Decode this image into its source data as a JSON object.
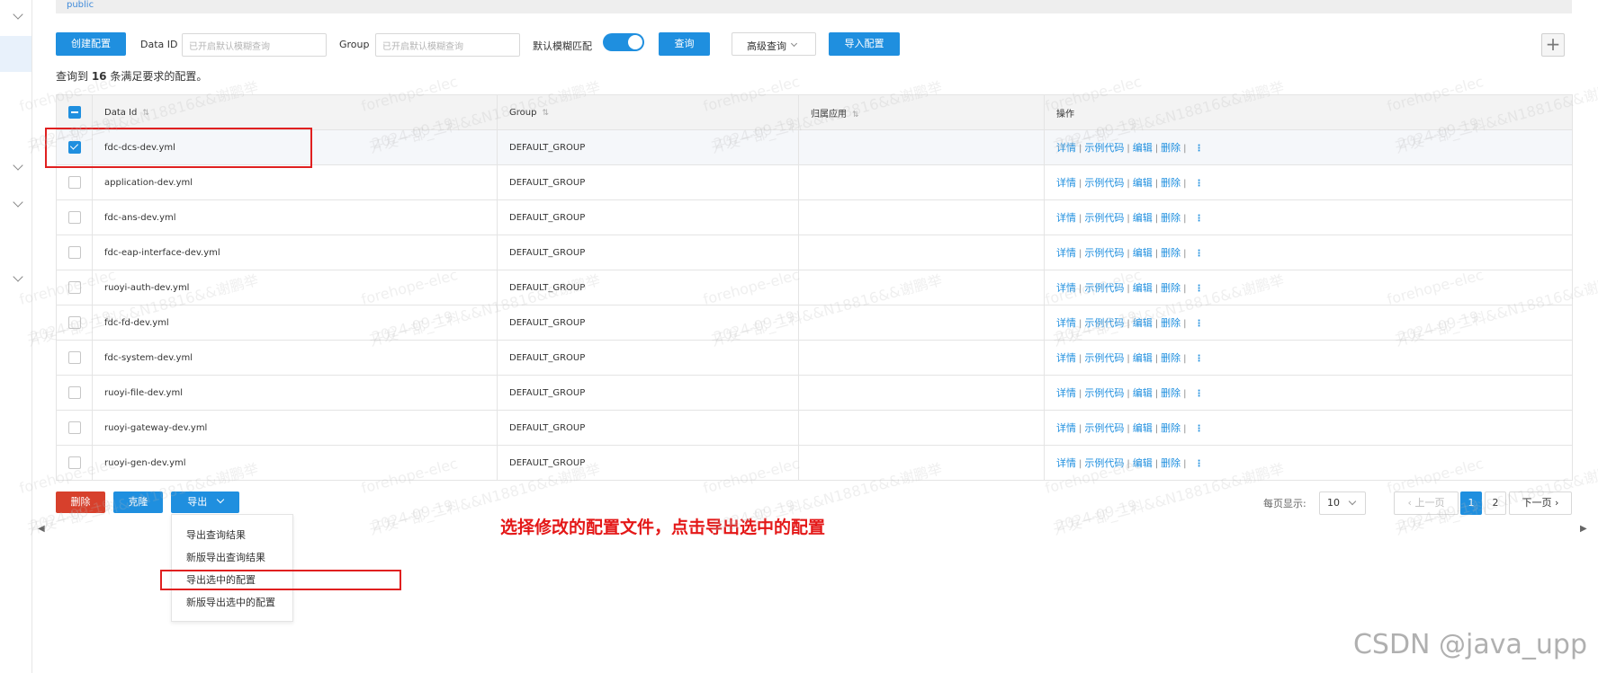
{
  "namespace": {
    "label": "public"
  },
  "toolbar": {
    "create_label": "创建配置",
    "data_id_label": "Data ID",
    "data_id_placeholder": "已开启默认模糊查询",
    "group_label": "Group",
    "group_placeholder": "已开启默认模糊查询",
    "fuzzy_label": "默认模糊匹配",
    "query_label": "查询",
    "advanced_label": "高级查询",
    "import_label": "导入配置"
  },
  "summary": {
    "prefix": "查询到 ",
    "count": "16",
    "suffix": " 条满足要求的配置。"
  },
  "table": {
    "headers": [
      "Data Id",
      "Group",
      "归属应用",
      "操作"
    ],
    "rows": [
      {
        "data_id": "fdc-dcs-dev.yml",
        "group": "DEFAULT_GROUP",
        "app": "",
        "checked": true
      },
      {
        "data_id": "application-dev.yml",
        "group": "DEFAULT_GROUP",
        "app": "",
        "checked": false
      },
      {
        "data_id": "fdc-ans-dev.yml",
        "group": "DEFAULT_GROUP",
        "app": "",
        "checked": false
      },
      {
        "data_id": "fdc-eap-interface-dev.yml",
        "group": "DEFAULT_GROUP",
        "app": "",
        "checked": false
      },
      {
        "data_id": "ruoyi-auth-dev.yml",
        "group": "DEFAULT_GROUP",
        "app": "",
        "checked": false
      },
      {
        "data_id": "fdc-fd-dev.yml",
        "group": "DEFAULT_GROUP",
        "app": "",
        "checked": false
      },
      {
        "data_id": "fdc-system-dev.yml",
        "group": "DEFAULT_GROUP",
        "app": "",
        "checked": false
      },
      {
        "data_id": "ruoyi-file-dev.yml",
        "group": "DEFAULT_GROUP",
        "app": "",
        "checked": false
      },
      {
        "data_id": "ruoyi-gateway-dev.yml",
        "group": "DEFAULT_GROUP",
        "app": "",
        "checked": false
      },
      {
        "data_id": "ruoyi-gen-dev.yml",
        "group": "DEFAULT_GROUP",
        "app": "",
        "checked": false
      }
    ],
    "ops": {
      "detail": "详情",
      "sample": "示例代码",
      "edit": "编辑",
      "delete": "删除",
      "sep": "|",
      "more": "⋮"
    }
  },
  "bottom": {
    "delete_label": "删除",
    "clone_label": "克隆",
    "export_label": "导出",
    "export_menu": [
      "导出查询结果",
      "新版导出查询结果",
      "导出选中的配置",
      "新版导出选中的配置"
    ]
  },
  "annotation": "选择修改的配置文件，点击导出选中的配置",
  "pagination": {
    "page_size_label": "每页显示:",
    "page_size": "10",
    "prev_label": "上一页",
    "next_label": "下一页",
    "pages": [
      "1",
      "2"
    ],
    "current": "1"
  },
  "watermark": {
    "lines": [
      "forehope-elec",
      "开发一部_二科&&N18816&&谢鹏举",
      "2024-09-19"
    ]
  },
  "credit": "CSDN @java_upp",
  "colors": {
    "primary": "#1f8fdf",
    "danger": "#d7402c",
    "annotation": "#e41818"
  }
}
